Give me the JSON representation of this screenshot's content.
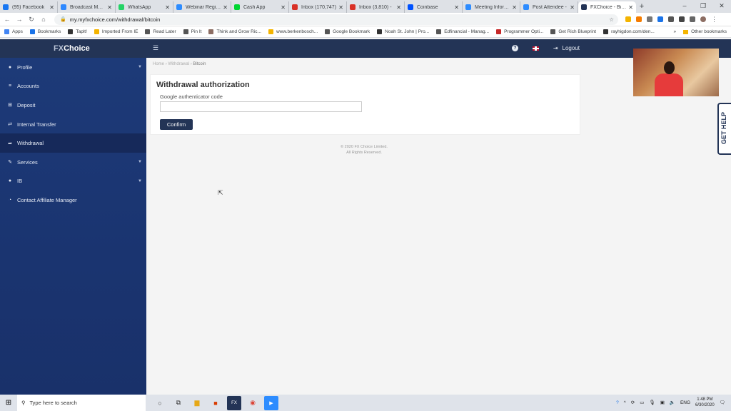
{
  "browser": {
    "tabs": [
      {
        "label": "(95) Facebook",
        "color": "#1877f2"
      },
      {
        "label": "Broadcast Messa",
        "color": "#2d88ff"
      },
      {
        "label": "WhatsApp",
        "color": "#25d366"
      },
      {
        "label": "Webinar Registr",
        "color": "#2d8cff"
      },
      {
        "label": "Cash App",
        "color": "#00d632"
      },
      {
        "label": "Inbox (170,747)",
        "color": "#d93025"
      },
      {
        "label": "Inbox (3,810) - ",
        "color": "#d93025"
      },
      {
        "label": "Coinbase",
        "color": "#0052ff"
      },
      {
        "label": "Meeting Informa",
        "color": "#2d8cff"
      },
      {
        "label": "Post Attendee -",
        "color": "#2d8cff"
      },
      {
        "label": "FXChoice - Bitco",
        "color": "#233456",
        "active": true
      }
    ],
    "url": "my.myfxchoice.com/withdrawal/bitcoin",
    "bookmarks": [
      "Apps",
      "Bookmarks",
      "Taplt!",
      "Imported From IE",
      "Read Later",
      "Pin It",
      "Think and Grow Ric...",
      "www.berkenbosch...",
      "Google Bookmark",
      "Noah St. John | Pro...",
      "Edfinancial - Manag...",
      "Programmer Opti...",
      "Get Rich Blueprint",
      "rayhigdon.com/den..."
    ],
    "other_bookmarks": "Other bookmarks"
  },
  "header": {
    "logo_prefix": "FX",
    "logo_suffix": "Choice",
    "help_icon": "question-circle-icon",
    "language": "UK flag",
    "logout": "Logout"
  },
  "sidebar": {
    "items": [
      {
        "label": "Profile",
        "icon": "user-icon",
        "has_submenu": true
      },
      {
        "label": "Accounts",
        "icon": "list-icon"
      },
      {
        "label": "Deposit",
        "icon": "plus-square-icon"
      },
      {
        "label": "Internal Transfer",
        "icon": "transfer-icon"
      },
      {
        "label": "Withdrawal",
        "icon": "arrow-right-icon",
        "active": true
      },
      {
        "label": "Services",
        "icon": "wrench-icon",
        "has_submenu": true
      },
      {
        "label": "IB",
        "icon": "users-icon",
        "has_submenu": true
      },
      {
        "label": "Contact Affiliate Manager",
        "icon": "chat-icon"
      }
    ]
  },
  "breadcrumb": {
    "home": "Home",
    "withdrawal": "Withdrawal",
    "current": "Bitcoin"
  },
  "form": {
    "title": "Withdrawal authorization",
    "field_label": "Google authenticator code",
    "field_value": "",
    "confirm_label": "Confirm"
  },
  "footer": {
    "line1": "© 2020 FX Choice Limited.",
    "line2": "All Rights Reserved."
  },
  "get_help": "GET HELP",
  "taskbar": {
    "search_placeholder": "Type here to search",
    "lang": "ENG",
    "time": "1:48 PM",
    "date": "6/30/2020"
  }
}
